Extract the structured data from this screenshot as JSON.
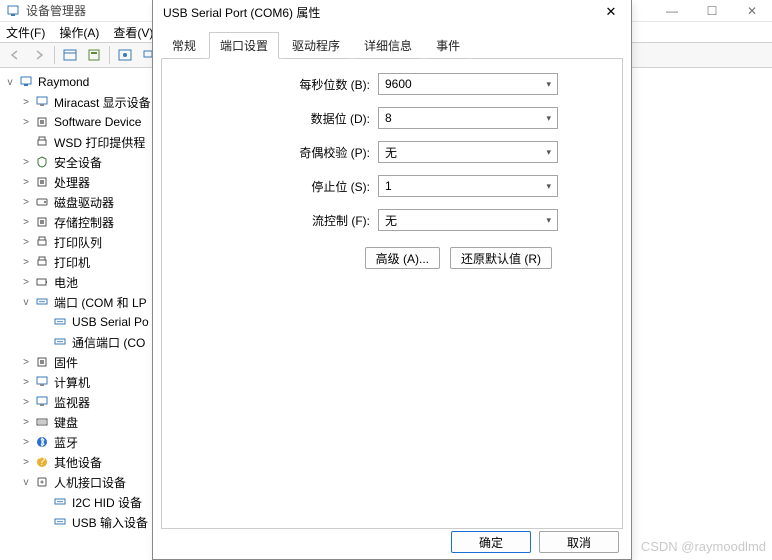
{
  "main": {
    "title": "设备管理器",
    "menu": [
      "文件(F)",
      "操作(A)",
      "查看(V)"
    ],
    "controls": {
      "min": "—",
      "max": "☐",
      "close": "✕"
    }
  },
  "tree": {
    "root": "Raymond",
    "items": [
      {
        "label": "Miracast 显示设备",
        "exp": ">"
      },
      {
        "label": "Software Device",
        "exp": ">"
      },
      {
        "label": "WSD 打印提供程",
        "exp": ""
      },
      {
        "label": "安全设备",
        "exp": ">"
      },
      {
        "label": "处理器",
        "exp": ">"
      },
      {
        "label": "磁盘驱动器",
        "exp": ">"
      },
      {
        "label": "存储控制器",
        "exp": ">"
      },
      {
        "label": "打印队列",
        "exp": ">"
      },
      {
        "label": "打印机",
        "exp": ">"
      },
      {
        "label": "电池",
        "exp": ">"
      },
      {
        "label": "端口 (COM 和 LP",
        "exp": "v",
        "children": [
          {
            "label": "USB Serial Po"
          },
          {
            "label": "通信端口 (CO"
          }
        ]
      },
      {
        "label": "固件",
        "exp": ">"
      },
      {
        "label": "计算机",
        "exp": ">"
      },
      {
        "label": "监视器",
        "exp": ">"
      },
      {
        "label": "键盘",
        "exp": ">"
      },
      {
        "label": "蓝牙",
        "exp": ">"
      },
      {
        "label": "其他设备",
        "exp": ">"
      },
      {
        "label": "人机接口设备",
        "exp": "v",
        "children": [
          {
            "label": "I2C HID 设备"
          },
          {
            "label": "USB 输入设备"
          }
        ]
      }
    ]
  },
  "dialog": {
    "title": "USB Serial Port (COM6) 属性",
    "tabs": [
      "常规",
      "端口设置",
      "驱动程序",
      "详细信息",
      "事件"
    ],
    "active_tab": 1,
    "fields": [
      {
        "label": "每秒位数 (B):",
        "value": "9600"
      },
      {
        "label": "数据位 (D):",
        "value": "8"
      },
      {
        "label": "奇偶校验 (P):",
        "value": "无"
      },
      {
        "label": "停止位 (S):",
        "value": "1"
      },
      {
        "label": "流控制 (F):",
        "value": "无"
      }
    ],
    "advanced": "高级 (A)...",
    "restore": "还原默认值 (R)",
    "ok": "确定",
    "cancel": "取消"
  },
  "watermark": "CSDN @raymoodlmd"
}
